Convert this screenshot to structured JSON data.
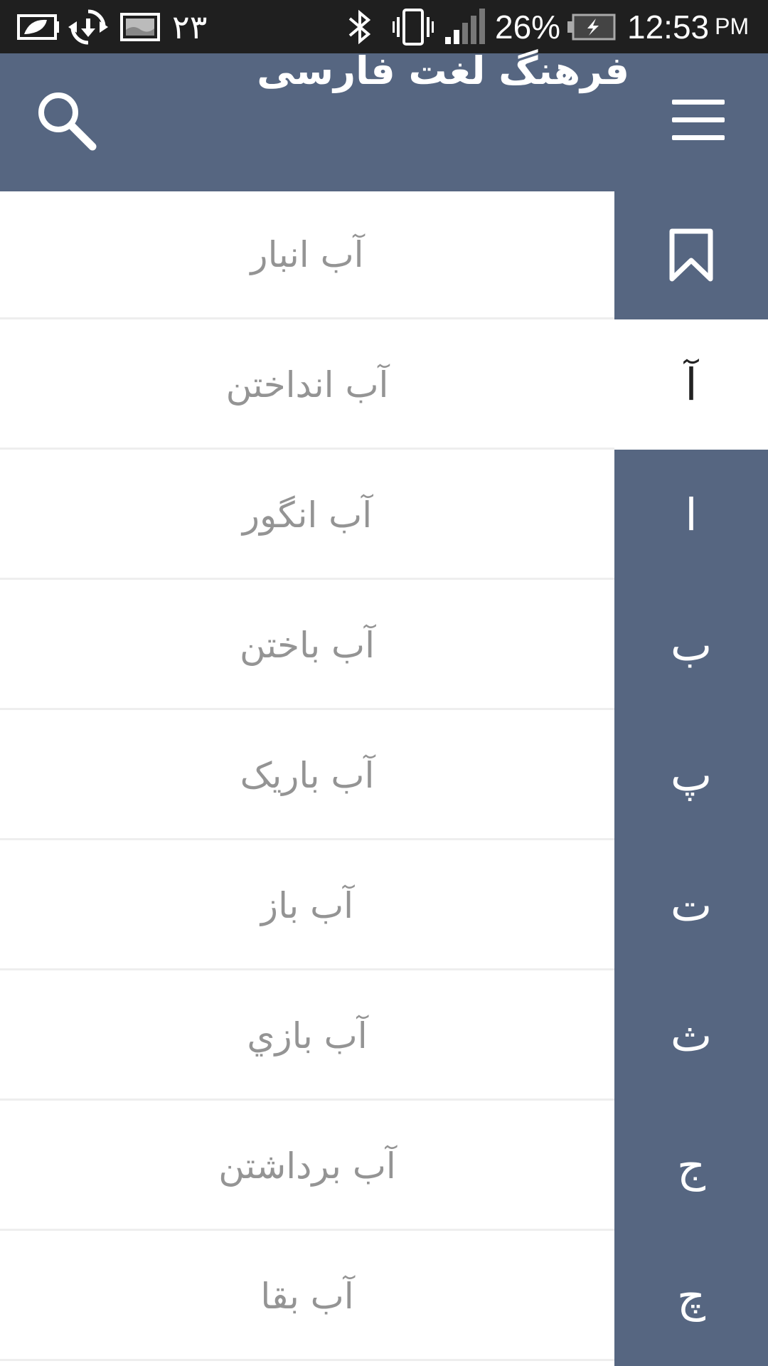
{
  "status_bar": {
    "notification_count": "۲۳",
    "battery_percent": "26%",
    "time": "12:53",
    "ampm": "PM",
    "icons": [
      "leaf-battery-icon",
      "sync-download-icon",
      "image-icon",
      "bluetooth-icon",
      "vibrate-icon",
      "signal-icon",
      "battery-charging-icon"
    ]
  },
  "app_bar": {
    "title": "فرهنگ لغت فارسی",
    "icons": [
      "menu-icon",
      "search-icon"
    ]
  },
  "words": [
    "آب انبار",
    "آب انداختن",
    "آب انگور",
    "آب باختن",
    "آب باریک",
    "آب باز",
    "آب بازي",
    "آب برداشتن",
    "آب بقا"
  ],
  "index": {
    "bookmark_icon": "bookmark-icon",
    "selected_letter": "آ",
    "letters": [
      "آ",
      "ا",
      "ب",
      "پ",
      "ت",
      "ث",
      "ج",
      "چ"
    ]
  },
  "colors": {
    "primary": "#566681",
    "status_bar": "#1f1f1f",
    "word_text": "#949494",
    "divider": "#eeeeee"
  }
}
